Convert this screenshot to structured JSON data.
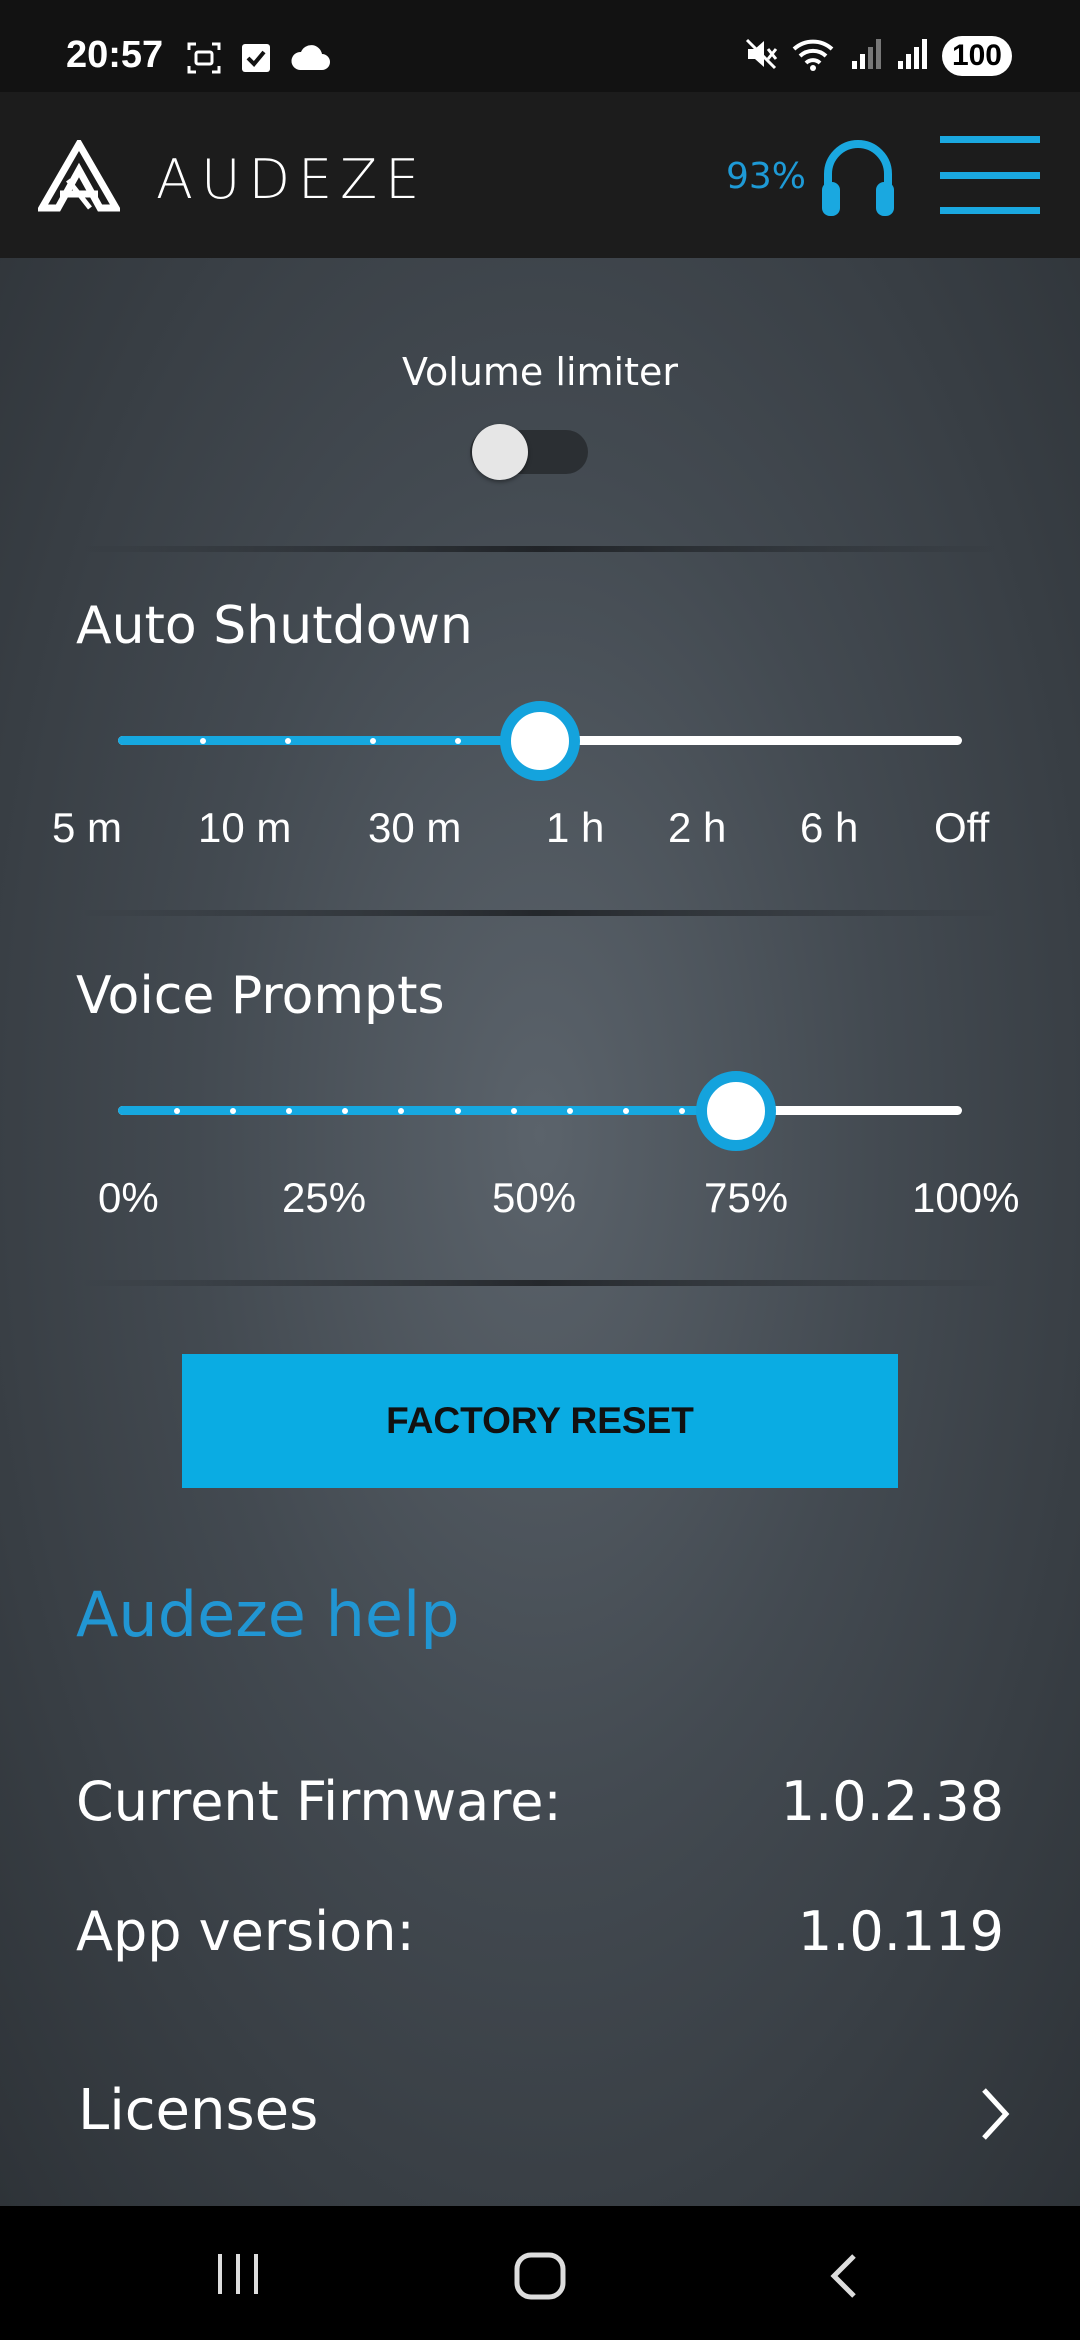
{
  "status_bar": {
    "time": "20:57",
    "battery": "100",
    "icons": [
      "screenshot-icon",
      "checkbox-icon",
      "cloud-icon",
      "mute-icon",
      "wifi-icon",
      "signal-icon",
      "signal-icon-2",
      "battery-icon"
    ]
  },
  "header": {
    "brand": "AUDEZE",
    "battery_percent": "93%",
    "icons": [
      "audeze-logo-icon",
      "headphones-icon",
      "menu-icon"
    ],
    "accent_color": "#1aa8e0"
  },
  "volume_limiter": {
    "label": "Volume limiter",
    "enabled": false
  },
  "auto_shutdown": {
    "title": "Auto Shutdown",
    "options": [
      "5 m",
      "10 m",
      "30 m",
      "1 h",
      "2 h",
      "6 h",
      "Off"
    ],
    "selected_fraction": 0.5
  },
  "voice_prompts": {
    "title": "Voice Prompts",
    "ticks": [
      "0%",
      "25%",
      "50%",
      "75%",
      "100%"
    ],
    "value_percent": 73
  },
  "factory_reset": {
    "label": "FACTORY RESET"
  },
  "help": {
    "label": "Audeze help"
  },
  "info": {
    "firmware_label": "Current Firmware:",
    "firmware_value": "1.0.2.38",
    "app_label": "App version:",
    "app_value": "1.0.119"
  },
  "licenses": {
    "label": "Licenses"
  },
  "nav": {
    "icons": [
      "recent-apps-icon",
      "home-icon",
      "back-icon"
    ]
  }
}
